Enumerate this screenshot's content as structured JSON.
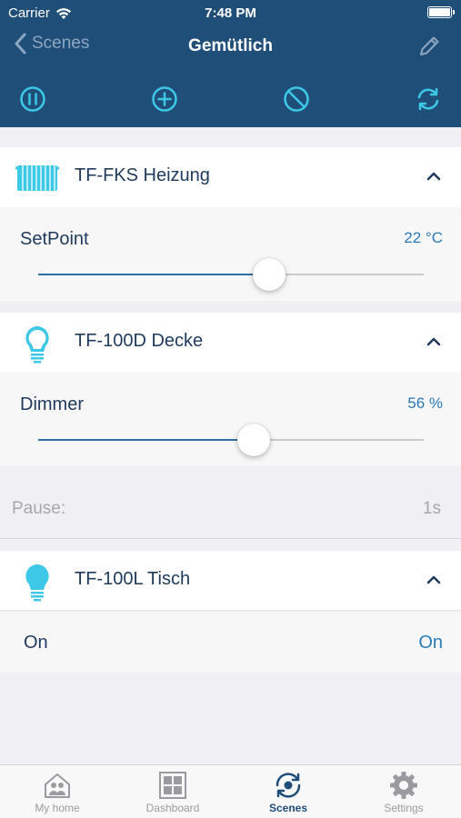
{
  "status_bar": {
    "carrier": "Carrier",
    "time": "7:48 PM"
  },
  "nav": {
    "back_label": "Scenes",
    "title": "Gemütlich"
  },
  "toolbar": {
    "icons": [
      "pause-icon",
      "add-icon",
      "disable-icon",
      "refresh-icon"
    ]
  },
  "devices": [
    {
      "name": "TF-FKS Heizung",
      "icon": "radiator-icon",
      "param_label": "SetPoint",
      "param_value": "22 °C",
      "slider_fraction": 0.6
    },
    {
      "name": "TF-100D Decke",
      "icon": "bulb-outline-icon",
      "param_label": "Dimmer",
      "param_value": "56 %",
      "slider_fraction": 0.56
    },
    {
      "name": "TF-100L Tisch",
      "icon": "bulb-icon",
      "param_label": "On",
      "param_value": "On"
    }
  ],
  "pause": {
    "label": "Pause:",
    "value": "1s"
  },
  "tabs": [
    {
      "label": "My home",
      "icon": "home-icon"
    },
    {
      "label": "Dashboard",
      "icon": "dashboard-icon"
    },
    {
      "label": "Scenes",
      "icon": "scenes-icon",
      "active": true
    },
    {
      "label": "Settings",
      "icon": "gear-icon"
    }
  ],
  "colors": {
    "header": "#1f4e79",
    "accent_cyan": "#3cc8e6",
    "value_blue": "#2a7ab8",
    "slider_fill": "#2f6ea5"
  }
}
